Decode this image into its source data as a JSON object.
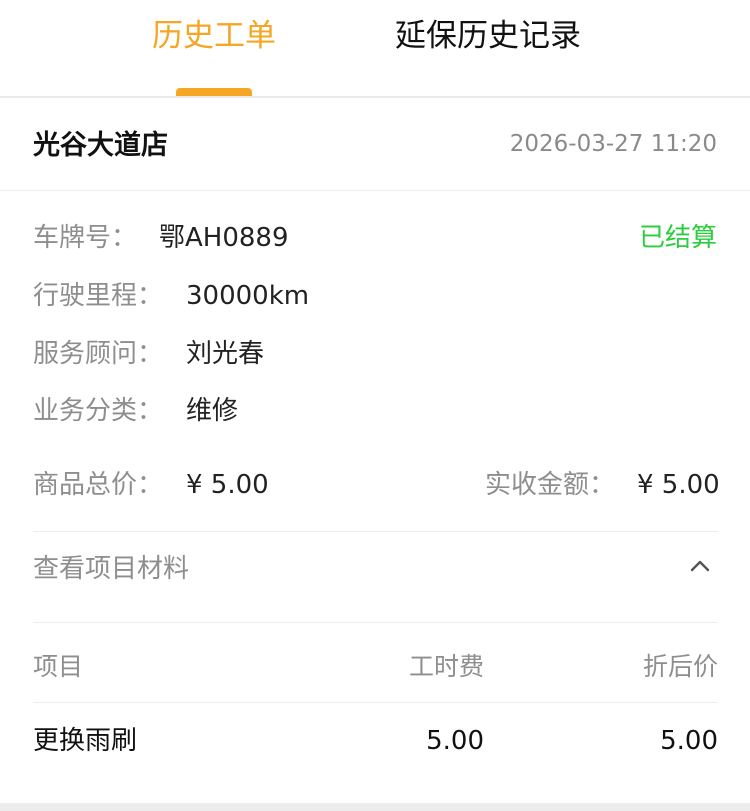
{
  "tabs": [
    {
      "label": "历史工单",
      "active": true
    },
    {
      "label": "延保历史记录",
      "active": false
    }
  ],
  "order": {
    "store": "光谷大道店",
    "datetime": "2026-03-27  11:20",
    "status": "已结算",
    "fields": [
      {
        "label": "车牌号：",
        "value": "鄂AH0889"
      },
      {
        "label": "行驶里程：",
        "value": "30000km"
      },
      {
        "label": "服务顾问：",
        "value": "刘光春"
      },
      {
        "label": "业务分类：",
        "value": "维修"
      }
    ],
    "goods_total_label": "商品总价：",
    "goods_total_value": "¥  5.00",
    "received_label": "实收金额：",
    "received_value": "¥  5.00",
    "toggle_label": "查看项目材料",
    "items_table": {
      "headers": [
        "项目",
        "工时费",
        "折后价"
      ],
      "rows": [
        [
          "更换雨刷",
          "5.00",
          "5.00"
        ]
      ]
    }
  },
  "colors": {
    "accent": "#f5a623",
    "status_green": "#2ecc40"
  },
  "icons": {
    "toggle": "chevron-up-icon"
  }
}
